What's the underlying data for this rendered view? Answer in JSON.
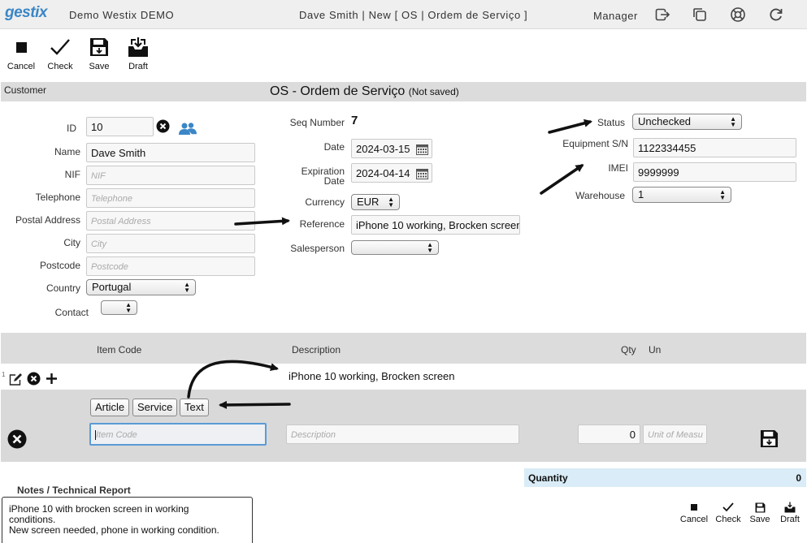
{
  "header": {
    "logo": "gestix",
    "company": "Demo Westix DEMO",
    "title": "Dave Smith | New [ OS | Ordem de Serviço ]",
    "role": "Manager"
  },
  "toolbar": {
    "cancel": "Cancel",
    "check": "Check",
    "save": "Save",
    "draft": "Draft"
  },
  "section": {
    "customer_label": "Customer",
    "form_title": "OS - Ordem de Serviço",
    "status_note": "(Not saved)"
  },
  "customer": {
    "id_label": "ID",
    "id_value": "10",
    "name_label": "Name",
    "name_value": "Dave Smith",
    "nif_label": "NIF",
    "nif_placeholder": "NIF",
    "telephone_label": "Telephone",
    "telephone_placeholder": "Telephone",
    "postal_label": "Postal Address",
    "postal_placeholder": "Postal Address",
    "city_label": "City",
    "city_placeholder": "City",
    "postcode_label": "Postcode",
    "postcode_placeholder": "Postcode",
    "country_label": "Country",
    "country_value": "Portugal",
    "contact_label": "Contact"
  },
  "document": {
    "seq_label": "Seq Number",
    "seq_value": "7",
    "date_label": "Date",
    "date_value": "2024-03-15",
    "expiration_label_1": "Expiration",
    "expiration_label_2": "Date",
    "expiration_value": "2024-04-14",
    "currency_label": "Currency",
    "currency_value": "EUR",
    "reference_label": "Reference",
    "reference_value": "iPhone 10 working, Brocken screen",
    "salesperson_label": "Salesperson"
  },
  "equipment": {
    "status_label": "Status",
    "status_value": "Unchecked",
    "serial_label": "Equipment S/N",
    "serial_value": "1122334455",
    "imei_label": "IMEI",
    "imei_value": "9999999",
    "warehouse_label": "Warehouse",
    "warehouse_value": "1"
  },
  "lines": {
    "headers": {
      "item_code": "Item Code",
      "description": "Description",
      "qty": "Qty",
      "unit": "Un"
    },
    "row_number": "1",
    "row_description": "iPhone 10 working, Brocken screen",
    "type_buttons": [
      "Article",
      "Service",
      "Text"
    ],
    "item_code_placeholder": "Item Code",
    "description_placeholder": "Description",
    "qty_value": "0",
    "unit_placeholder": "Unit of Measu"
  },
  "notes": {
    "title": "Notes / Technical Report",
    "line1": "iPhone 10 with brocken screen in working",
    "line2": "conditions.",
    "line3": "New screen needed, phone in working condition."
  },
  "summary": {
    "quantity_label": "Quantity",
    "quantity_value": "0"
  },
  "footer_toolbar": {
    "cancel": "Cancel",
    "check": "Check",
    "save": "Save",
    "draft": "Draft"
  }
}
